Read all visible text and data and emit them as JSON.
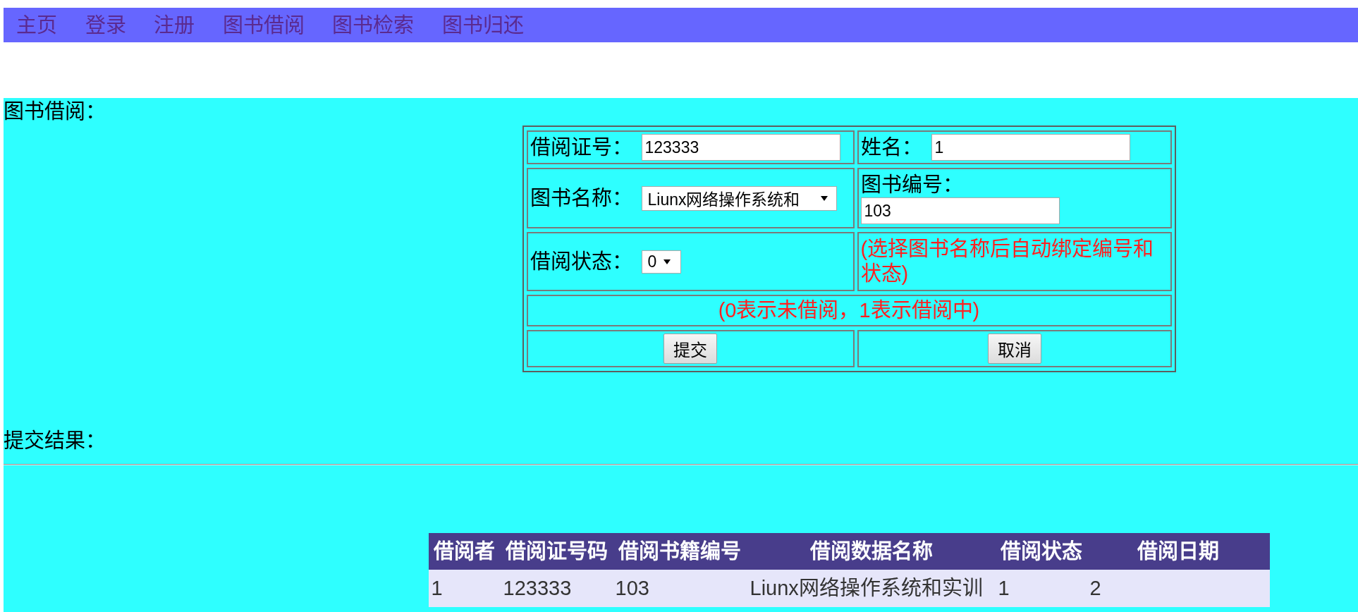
{
  "nav_links": [
    "主页",
    "登录",
    "注册",
    "图书借阅",
    "图书检索",
    "图书归还"
  ],
  "borrow_section": {
    "title": "图书借阅：",
    "form": {
      "card_number": {
        "label": "借阅证号：",
        "value": "123333"
      },
      "name": {
        "label": "姓名：",
        "value": "1"
      },
      "book_name": {
        "label": "图书名称：",
        "value": "Liunx网络操作系统和"
      },
      "book_number": {
        "label": "图书编号：",
        "value": "103"
      },
      "borrow_status": {
        "label": "借阅状态：",
        "value": "0"
      },
      "auto_bind_note": "(选择图书名称后自动绑定编号和状态)",
      "status_legend": "(0表示未借阅，1表示借阅中)",
      "buttons": [
        "提交",
        "取消"
      ]
    }
  },
  "result_section": {
    "title": "提交结果：",
    "table": {
      "columns": [
        "借阅者",
        "借阅证号码",
        "借阅书籍编号",
        "借阅数据名称",
        "借阅状态",
        "借阅日期"
      ],
      "rows": [
        [
          "1",
          "123333",
          "103",
          "Liunx网络操作系统和实训",
          "1",
          "2"
        ]
      ]
    }
  }
}
